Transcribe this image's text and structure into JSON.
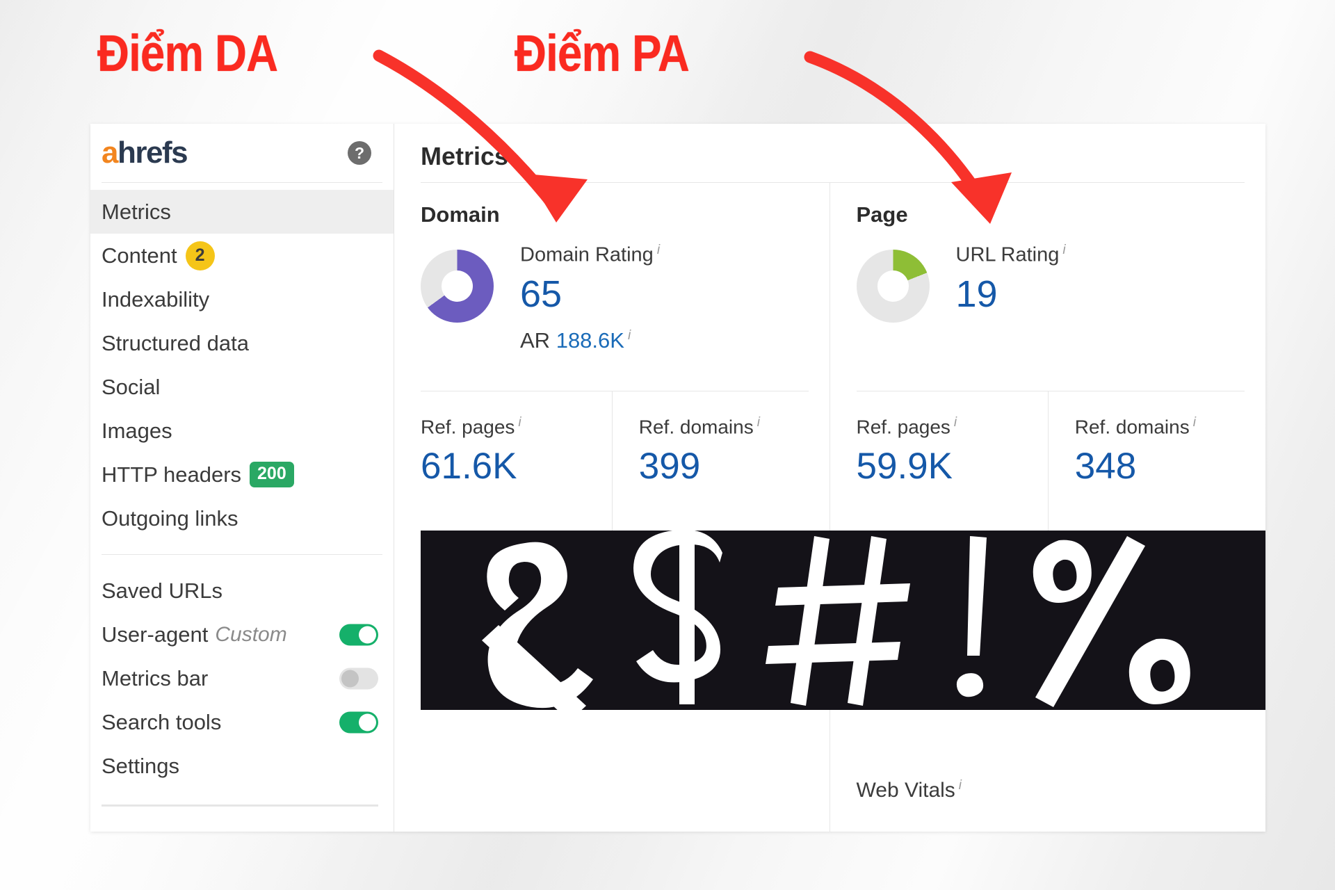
{
  "annotations": {
    "da_label": "Điểm DA",
    "pa_label": "Điểm PA",
    "color": "#fa2a20"
  },
  "sidebar": {
    "brand": {
      "accent_letter": "a",
      "rest": "hrefs",
      "accent_color": "#f2851f",
      "text_color": "#2b3a50"
    },
    "help_icon_glyph": "?",
    "nav": [
      {
        "label": "Metrics",
        "active": true
      },
      {
        "label": "Content",
        "badge": "2",
        "badge_type": "count",
        "badge_color": "#f5c518"
      },
      {
        "label": "Indexability"
      },
      {
        "label": "Structured data"
      },
      {
        "label": "Social"
      },
      {
        "label": "Images"
      },
      {
        "label": "HTTP headers",
        "badge": "200",
        "badge_type": "status",
        "badge_color": "#2aa864"
      },
      {
        "label": "Outgoing links"
      }
    ],
    "settings": [
      {
        "label": "Saved URLs"
      },
      {
        "label": "User-agent",
        "sub": "Custom",
        "toggle": "on"
      },
      {
        "label": "Metrics bar",
        "toggle": "off"
      },
      {
        "label": "Search tools",
        "toggle": "on"
      },
      {
        "label": "Settings"
      }
    ]
  },
  "main": {
    "title": "Metrics",
    "info_glyph": "i",
    "domain": {
      "heading": "Domain",
      "rating_label": "Domain Rating",
      "rating_value": "65",
      "rating_percent": 65,
      "rating_color": "#6c5cbf",
      "ar_prefix": "AR",
      "ar_value": "188.6K",
      "ref_pages_label": "Ref. pages",
      "ref_pages_value": "61.6K",
      "ref_domains_label": "Ref. domains",
      "ref_domains_value": "399"
    },
    "page": {
      "heading": "Page",
      "rating_label": "URL Rating",
      "rating_value": "19",
      "rating_percent": 19,
      "rating_color": "#8ebe36",
      "ref_pages_label": "Ref. pages",
      "ref_pages_value": "59.9K",
      "ref_domains_label": "Ref. domains",
      "ref_domains_value": "348",
      "web_vitals_label": "Web Vitals"
    },
    "censored_panel": {
      "glyphs": "&$#!%",
      "background": "#141218",
      "foreground": "#ffffff"
    }
  }
}
